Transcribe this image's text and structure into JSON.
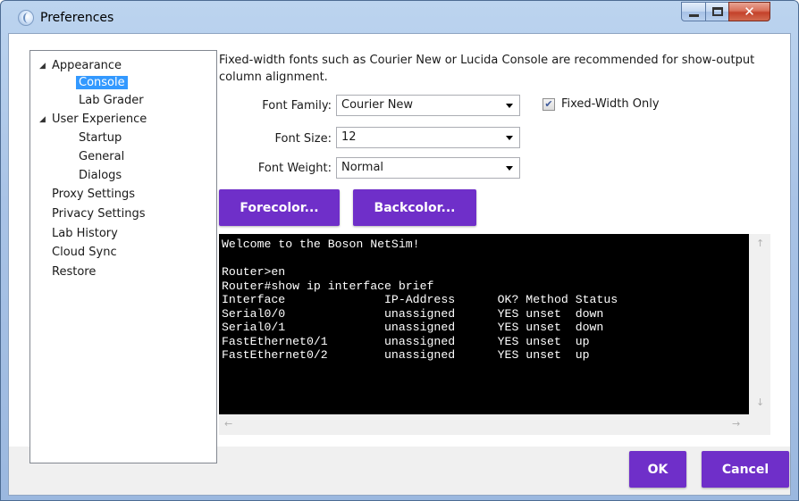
{
  "window": {
    "title": "Preferences"
  },
  "tree": {
    "items": [
      {
        "label": "Appearance",
        "expanded": true
      },
      {
        "label": "Console",
        "selected": true
      },
      {
        "label": "Lab Grader"
      },
      {
        "label": "User Experience",
        "expanded": true
      },
      {
        "label": "Startup"
      },
      {
        "label": "General"
      },
      {
        "label": "Dialogs"
      },
      {
        "label": "Proxy Settings"
      },
      {
        "label": "Privacy Settings"
      },
      {
        "label": "Lab History"
      },
      {
        "label": "Cloud Sync"
      },
      {
        "label": "Restore"
      }
    ]
  },
  "console_settings": {
    "description": "Fixed-width fonts such as Courier New or Lucida Console are recommended for show-output column alignment.",
    "font_family_label": "Font Family:",
    "font_family_value": "Courier New",
    "font_size_label": "Font Size:",
    "font_size_value": "12",
    "font_weight_label": "Font Weight:",
    "font_weight_value": "Normal",
    "fixed_width_label": "Fixed-Width Only",
    "fixed_width_checked": true,
    "forecolor_label": "Forecolor...",
    "backcolor_label": "Backcolor..."
  },
  "console_preview": {
    "lines": [
      "Welcome to the Boson NetSim!",
      "",
      "Router>en",
      "Router#show ip interface brief",
      "Interface              IP-Address      OK? Method Status",
      "Serial0/0              unassigned      YES unset  down",
      "Serial0/1              unassigned      YES unset  down",
      "FastEthernet0/1        unassigned      YES unset  up",
      "FastEthernet0/2        unassigned      YES unset  up"
    ]
  },
  "buttons": {
    "ok_label": "OK",
    "cancel_label": "Cancel"
  },
  "colors": {
    "accent": "#6f2fc9",
    "console_background": "#000000",
    "console_foreground": "#ffffff",
    "selection": "#3399ff"
  }
}
